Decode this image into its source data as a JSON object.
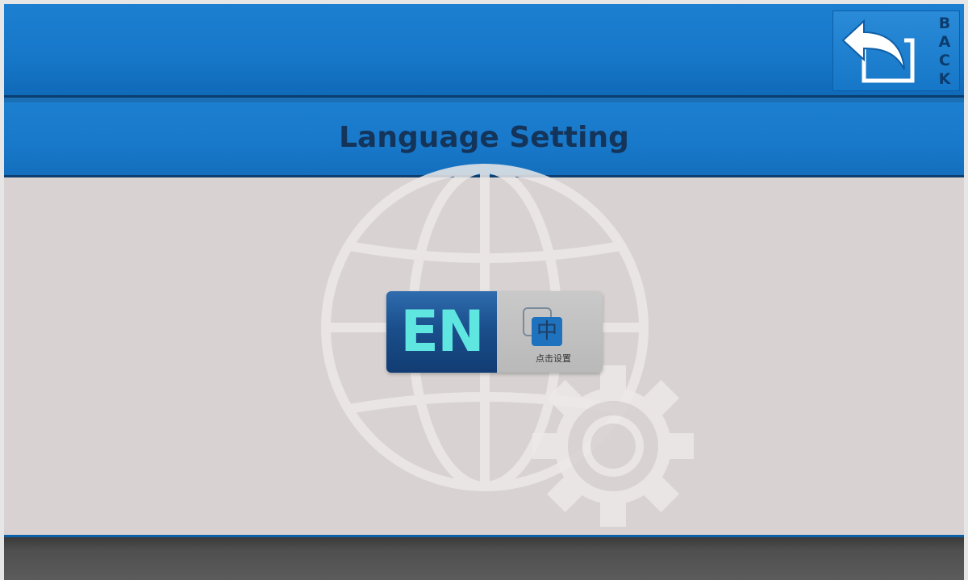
{
  "header": {
    "back_label": [
      "B",
      "A",
      "C",
      "K"
    ],
    "back_icon": "return-arrow-icon"
  },
  "page": {
    "title": "Language Setting"
  },
  "language_toggle": {
    "current": "EN",
    "alternate_char": "中",
    "alternate_caption": "点击设置",
    "alternate_icon": "language-switch-icon"
  },
  "background": {
    "watermark_icons": [
      "globe-icon",
      "gear-icon"
    ]
  },
  "colors": {
    "header_blue": "#1778ca",
    "content_bg": "#d8d3d2",
    "en_text": "#5fe6e0",
    "footer": "#4f4f4f"
  }
}
